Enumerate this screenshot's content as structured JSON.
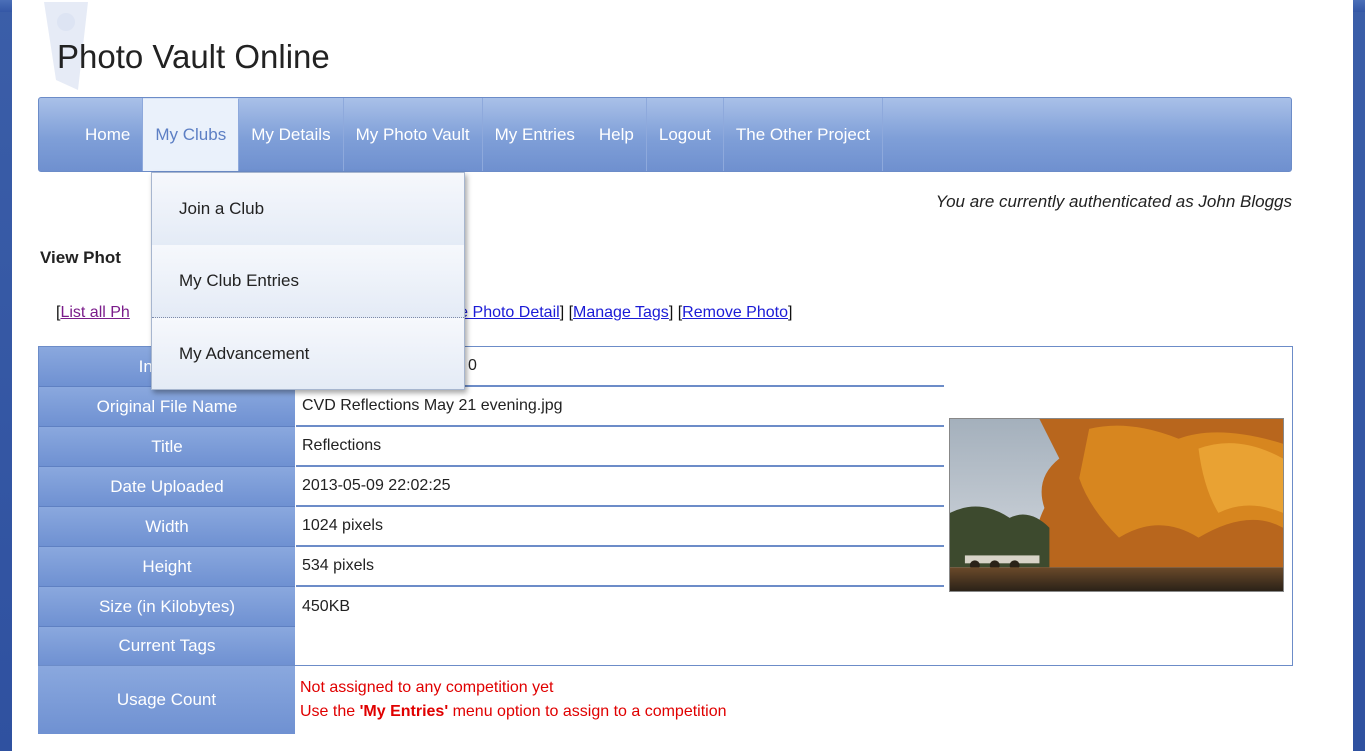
{
  "site": {
    "title": "Photo Vault Online"
  },
  "nav": {
    "items": [
      {
        "label": "Home"
      },
      {
        "label": "My Clubs"
      },
      {
        "label": "My Details"
      },
      {
        "label": "My Photo Vault"
      },
      {
        "label": "My Entries"
      },
      {
        "label": "Help"
      },
      {
        "label": "Logout"
      },
      {
        "label": "The Other Project"
      }
    ],
    "active": "My Clubs"
  },
  "dropdown": {
    "items": [
      {
        "label": "Join a Club"
      },
      {
        "label": "My Club Entries"
      },
      {
        "label": "My Advancement"
      }
    ]
  },
  "auth": {
    "text": "You are currently authenticated as John Bloggs"
  },
  "section": {
    "title": "View Phot"
  },
  "links": {
    "list_all": "List all Ph",
    "update": "ate Photo Detail",
    "manage_tags": "Manage Tags",
    "remove": "Remove Photo"
  },
  "details": {
    "rows": [
      {
        "label": "Internal",
        "value": "0"
      },
      {
        "label": "Original File Name",
        "value": "CVD Reflections May 21 evening.jpg"
      },
      {
        "label": "Title",
        "value": "Reflections"
      },
      {
        "label": "Date Uploaded",
        "value": "2013-05-09 22:02:25"
      },
      {
        "label": "Width",
        "value": "1024 pixels"
      },
      {
        "label": "Height",
        "value": "534 pixels"
      },
      {
        "label": "Size (in Kilobytes)",
        "value": "450KB"
      },
      {
        "label": "Current Tags",
        "value": ""
      }
    ],
    "usage": {
      "label": "Usage Count",
      "line1": "Not assigned to any competition yet",
      "line2_prefix": "Use the ",
      "line2_bold": "'My Entries'",
      "line2_suffix": " menu option to assign to a competition"
    }
  }
}
